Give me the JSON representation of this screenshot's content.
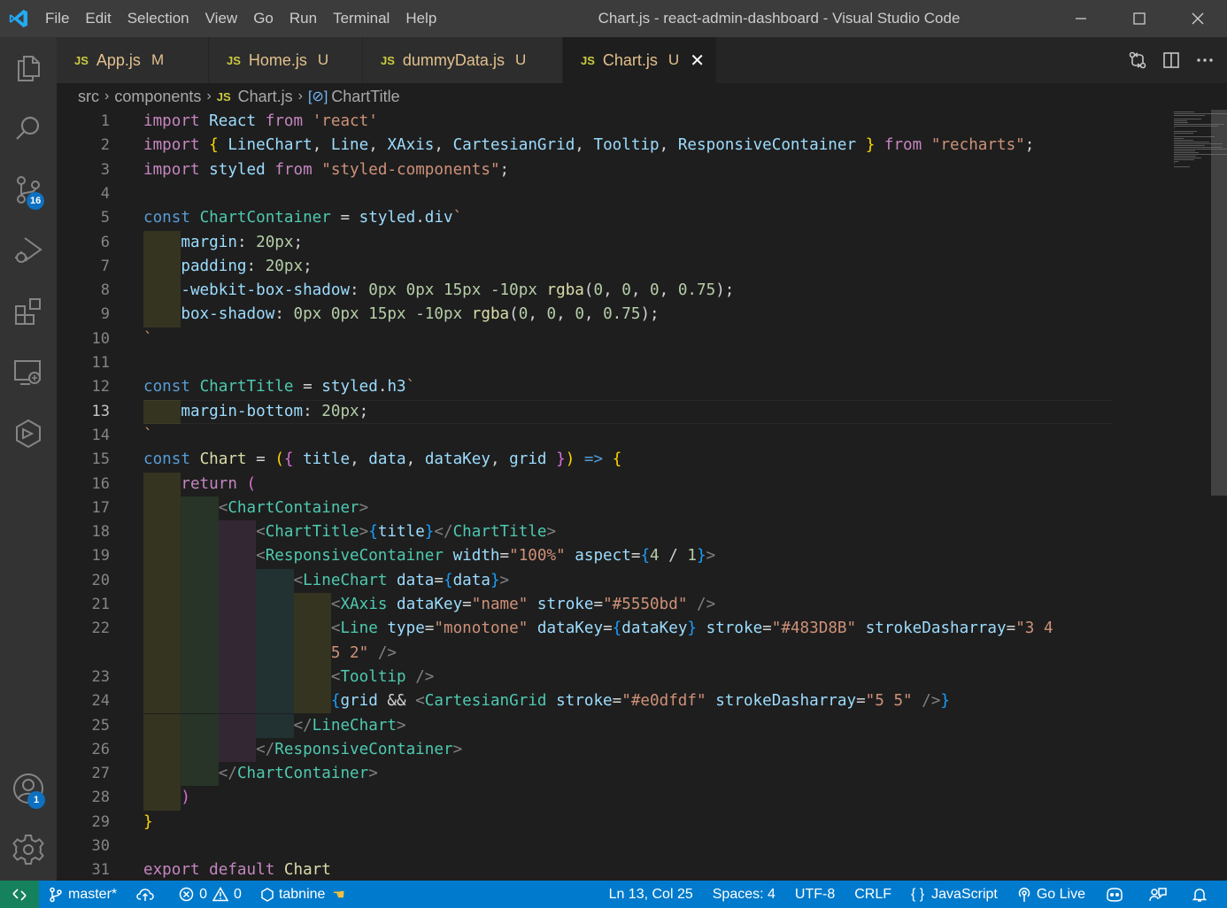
{
  "window": {
    "title": "Chart.js - react-admin-dashboard - Visual Studio Code"
  },
  "menu": [
    "File",
    "Edit",
    "Selection",
    "View",
    "Go",
    "Run",
    "Terminal",
    "Help"
  ],
  "activity": {
    "source_control_badge": "16",
    "accounts_badge": "1"
  },
  "tabs": [
    {
      "icon": "JS",
      "label": "App.js",
      "status": "M",
      "active": false
    },
    {
      "icon": "JS",
      "label": "Home.js",
      "status": "U",
      "active": false
    },
    {
      "icon": "JS",
      "label": "dummyData.js",
      "status": "U",
      "active": false
    },
    {
      "icon": "JS",
      "label": "Chart.js",
      "status": "U",
      "active": true
    }
  ],
  "breadcrumb": {
    "folder1": "src",
    "folder2": "components",
    "file_icon": "JS",
    "file": "Chart.js",
    "symbol": "ChartTitle"
  },
  "editor": {
    "current_line": 13,
    "line_numbers": [
      "1",
      "2",
      "3",
      "4",
      "5",
      "6",
      "7",
      "8",
      "9",
      "10",
      "11",
      "12",
      "13",
      "14",
      "15",
      "16",
      "17",
      "18",
      "19",
      "20",
      "21",
      "22",
      "",
      "23",
      "24",
      "25",
      "26",
      "27",
      "28",
      "29",
      "30",
      "31"
    ],
    "lines": [
      [
        [
          "kw2",
          "import"
        ],
        [
          "txt",
          " "
        ],
        [
          "var",
          "React"
        ],
        [
          "txt",
          " "
        ],
        [
          "kw2",
          "from"
        ],
        [
          "txt",
          " "
        ],
        [
          "str",
          "'react'"
        ]
      ],
      [
        [
          "kw2",
          "import"
        ],
        [
          "txt",
          " "
        ],
        [
          "br1",
          "{"
        ],
        [
          "txt",
          " "
        ],
        [
          "var",
          "LineChart"
        ],
        [
          "txt",
          ", "
        ],
        [
          "var",
          "Line"
        ],
        [
          "txt",
          ", "
        ],
        [
          "var",
          "XAxis"
        ],
        [
          "txt",
          ", "
        ],
        [
          "var",
          "CartesianGrid"
        ],
        [
          "txt",
          ", "
        ],
        [
          "var",
          "Tooltip"
        ],
        [
          "txt",
          ", "
        ],
        [
          "var",
          "ResponsiveContainer"
        ],
        [
          "txt",
          " "
        ],
        [
          "br1",
          "}"
        ],
        [
          "txt",
          " "
        ],
        [
          "kw2",
          "from"
        ],
        [
          "txt",
          " "
        ],
        [
          "str",
          "\"recharts\""
        ],
        [
          "txt",
          ";"
        ]
      ],
      [
        [
          "kw2",
          "import"
        ],
        [
          "txt",
          " "
        ],
        [
          "var",
          "styled"
        ],
        [
          "txt",
          " "
        ],
        [
          "kw2",
          "from"
        ],
        [
          "txt",
          " "
        ],
        [
          "str",
          "\"styled-components\""
        ],
        [
          "txt",
          ";"
        ]
      ],
      [],
      [
        [
          "kw",
          "const"
        ],
        [
          "txt",
          " "
        ],
        [
          "cls",
          "ChartContainer"
        ],
        [
          "txt",
          " = "
        ],
        [
          "var",
          "styled"
        ],
        [
          "txt",
          "."
        ],
        [
          "var",
          "div"
        ],
        [
          "str",
          "`"
        ]
      ],
      [
        [
          "txt",
          "    "
        ],
        [
          "var",
          "margin"
        ],
        [
          "txt",
          ": "
        ],
        [
          "num",
          "20px"
        ],
        [
          "txt",
          ";"
        ]
      ],
      [
        [
          "txt",
          "    "
        ],
        [
          "var",
          "padding"
        ],
        [
          "txt",
          ": "
        ],
        [
          "num",
          "20px"
        ],
        [
          "txt",
          ";"
        ]
      ],
      [
        [
          "txt",
          "    "
        ],
        [
          "var",
          "-webkit-box-shadow"
        ],
        [
          "txt",
          ": "
        ],
        [
          "num",
          "0px"
        ],
        [
          "txt",
          " "
        ],
        [
          "num",
          "0px"
        ],
        [
          "txt",
          " "
        ],
        [
          "num",
          "15px"
        ],
        [
          "txt",
          " "
        ],
        [
          "num",
          "-10px"
        ],
        [
          "txt",
          " "
        ],
        [
          "fn",
          "rgba"
        ],
        [
          "txt",
          "("
        ],
        [
          "num",
          "0"
        ],
        [
          "txt",
          ", "
        ],
        [
          "num",
          "0"
        ],
        [
          "txt",
          ", "
        ],
        [
          "num",
          "0"
        ],
        [
          "txt",
          ", "
        ],
        [
          "num",
          "0.75"
        ],
        [
          "txt",
          ");"
        ]
      ],
      [
        [
          "txt",
          "    "
        ],
        [
          "var",
          "box-shadow"
        ],
        [
          "txt",
          ": "
        ],
        [
          "num",
          "0px"
        ],
        [
          "txt",
          " "
        ],
        [
          "num",
          "0px"
        ],
        [
          "txt",
          " "
        ],
        [
          "num",
          "15px"
        ],
        [
          "txt",
          " "
        ],
        [
          "num",
          "-10px"
        ],
        [
          "txt",
          " "
        ],
        [
          "fn",
          "rgba"
        ],
        [
          "txt",
          "("
        ],
        [
          "num",
          "0"
        ],
        [
          "txt",
          ", "
        ],
        [
          "num",
          "0"
        ],
        [
          "txt",
          ", "
        ],
        [
          "num",
          "0"
        ],
        [
          "txt",
          ", "
        ],
        [
          "num",
          "0.75"
        ],
        [
          "txt",
          ");"
        ]
      ],
      [
        [
          "str",
          "`"
        ]
      ],
      [],
      [
        [
          "kw",
          "const"
        ],
        [
          "txt",
          " "
        ],
        [
          "cls",
          "ChartTitle"
        ],
        [
          "txt",
          " = "
        ],
        [
          "var",
          "styled"
        ],
        [
          "txt",
          "."
        ],
        [
          "var",
          "h3"
        ],
        [
          "str",
          "`"
        ]
      ],
      [
        [
          "txt",
          "    "
        ],
        [
          "var",
          "margin-bottom"
        ],
        [
          "txt",
          ": "
        ],
        [
          "num",
          "20px"
        ],
        [
          "txt",
          ";"
        ]
      ],
      [
        [
          "str",
          "`"
        ]
      ],
      [
        [
          "kw",
          "const"
        ],
        [
          "txt",
          " "
        ],
        [
          "fn",
          "Chart"
        ],
        [
          "txt",
          " = "
        ],
        [
          "br1",
          "("
        ],
        [
          "br2",
          "{"
        ],
        [
          "txt",
          " "
        ],
        [
          "var",
          "title"
        ],
        [
          "txt",
          ", "
        ],
        [
          "var",
          "data"
        ],
        [
          "txt",
          ", "
        ],
        [
          "var",
          "dataKey"
        ],
        [
          "txt",
          ", "
        ],
        [
          "var",
          "grid"
        ],
        [
          "txt",
          " "
        ],
        [
          "br2",
          "}"
        ],
        [
          "br1",
          ")"
        ],
        [
          "txt",
          " "
        ],
        [
          "kw",
          "=>"
        ],
        [
          "txt",
          " "
        ],
        [
          "br1",
          "{"
        ]
      ],
      [
        [
          "txt",
          "    "
        ],
        [
          "kw2",
          "return"
        ],
        [
          "txt",
          " "
        ],
        [
          "br2",
          "("
        ]
      ],
      [
        [
          "txt",
          "        "
        ],
        [
          "tag",
          "<"
        ],
        [
          "cls",
          "ChartContainer"
        ],
        [
          "tag",
          ">"
        ]
      ],
      [
        [
          "txt",
          "            "
        ],
        [
          "tag",
          "<"
        ],
        [
          "cls",
          "ChartTitle"
        ],
        [
          "tag",
          ">"
        ],
        [
          "br3",
          "{"
        ],
        [
          "var",
          "title"
        ],
        [
          "br3",
          "}"
        ],
        [
          "tag",
          "</"
        ],
        [
          "cls",
          "ChartTitle"
        ],
        [
          "tag",
          ">"
        ]
      ],
      [
        [
          "txt",
          "            "
        ],
        [
          "tag",
          "<"
        ],
        [
          "cls",
          "ResponsiveContainer"
        ],
        [
          "txt",
          " "
        ],
        [
          "attr",
          "width"
        ],
        [
          "txt",
          "="
        ],
        [
          "str",
          "\"100%\""
        ],
        [
          "txt",
          " "
        ],
        [
          "attr",
          "aspect"
        ],
        [
          "txt",
          "="
        ],
        [
          "br3",
          "{"
        ],
        [
          "num",
          "4"
        ],
        [
          "txt",
          " / "
        ],
        [
          "num",
          "1"
        ],
        [
          "br3",
          "}"
        ],
        [
          "tag",
          ">"
        ]
      ],
      [
        [
          "txt",
          "                "
        ],
        [
          "tag",
          "<"
        ],
        [
          "cls",
          "LineChart"
        ],
        [
          "txt",
          " "
        ],
        [
          "attr",
          "data"
        ],
        [
          "txt",
          "="
        ],
        [
          "br3",
          "{"
        ],
        [
          "var",
          "data"
        ],
        [
          "br3",
          "}"
        ],
        [
          "tag",
          ">"
        ]
      ],
      [
        [
          "txt",
          "                    "
        ],
        [
          "tag",
          "<"
        ],
        [
          "cls",
          "XAxis"
        ],
        [
          "txt",
          " "
        ],
        [
          "attr",
          "dataKey"
        ],
        [
          "txt",
          "="
        ],
        [
          "str",
          "\"name\""
        ],
        [
          "txt",
          " "
        ],
        [
          "attr",
          "stroke"
        ],
        [
          "txt",
          "="
        ],
        [
          "str",
          "\"#5550bd\""
        ],
        [
          "txt",
          " "
        ],
        [
          "tag",
          "/>"
        ]
      ],
      [
        [
          "txt",
          "                    "
        ],
        [
          "tag",
          "<"
        ],
        [
          "cls",
          "Line"
        ],
        [
          "txt",
          " "
        ],
        [
          "attr",
          "type"
        ],
        [
          "txt",
          "="
        ],
        [
          "str",
          "\"monotone\""
        ],
        [
          "txt",
          " "
        ],
        [
          "attr",
          "dataKey"
        ],
        [
          "txt",
          "="
        ],
        [
          "br3",
          "{"
        ],
        [
          "var",
          "dataKey"
        ],
        [
          "br3",
          "}"
        ],
        [
          "txt",
          " "
        ],
        [
          "attr",
          "stroke"
        ],
        [
          "txt",
          "="
        ],
        [
          "str",
          "\"#483D8B\""
        ],
        [
          "txt",
          " "
        ],
        [
          "attr",
          "strokeDasharray"
        ],
        [
          "txt",
          "="
        ],
        [
          "str",
          "\"3 4"
        ]
      ],
      [
        [
          "txt",
          "                    "
        ],
        [
          "str",
          "5 2\""
        ],
        [
          "txt",
          " "
        ],
        [
          "tag",
          "/>"
        ]
      ],
      [
        [
          "txt",
          "                    "
        ],
        [
          "tag",
          "<"
        ],
        [
          "cls",
          "Tooltip"
        ],
        [
          "txt",
          " "
        ],
        [
          "tag",
          "/>"
        ]
      ],
      [
        [
          "txt",
          "                    "
        ],
        [
          "br3",
          "{"
        ],
        [
          "var",
          "grid"
        ],
        [
          "txt",
          " && "
        ],
        [
          "tag",
          "<"
        ],
        [
          "cls",
          "CartesianGrid"
        ],
        [
          "txt",
          " "
        ],
        [
          "attr",
          "stroke"
        ],
        [
          "txt",
          "="
        ],
        [
          "str",
          "\"#e0dfdf\""
        ],
        [
          "txt",
          " "
        ],
        [
          "attr",
          "strokeDasharray"
        ],
        [
          "txt",
          "="
        ],
        [
          "str",
          "\"5 5\""
        ],
        [
          "txt",
          " "
        ],
        [
          "tag",
          "/>"
        ],
        [
          "br3",
          "}"
        ]
      ],
      [
        [
          "txt",
          "                "
        ],
        [
          "tag",
          "</"
        ],
        [
          "cls",
          "LineChart"
        ],
        [
          "tag",
          ">"
        ]
      ],
      [
        [
          "txt",
          "            "
        ],
        [
          "tag",
          "</"
        ],
        [
          "cls",
          "ResponsiveContainer"
        ],
        [
          "tag",
          ">"
        ]
      ],
      [
        [
          "txt",
          "        "
        ],
        [
          "tag",
          "</"
        ],
        [
          "cls",
          "ChartContainer"
        ],
        [
          "tag",
          ">"
        ]
      ],
      [
        [
          "txt",
          "    "
        ],
        [
          "br2",
          ")"
        ]
      ],
      [
        [
          "br1",
          "}"
        ]
      ],
      [],
      [
        [
          "kw2",
          "export"
        ],
        [
          "txt",
          " "
        ],
        [
          "kw2",
          "default"
        ],
        [
          "txt",
          " "
        ],
        [
          "fn",
          "Chart"
        ]
      ]
    ]
  },
  "status": {
    "branch": "master*",
    "errors": "0",
    "warnings": "0",
    "tabnine": "tabnine",
    "position": "Ln 13, Col 25",
    "spaces": "Spaces: 4",
    "encoding": "UTF-8",
    "eol": "CRLF",
    "language": "JavaScript",
    "golive": "Go Live"
  },
  "icons": [
    "vscode-logo-icon",
    "files-icon",
    "search-icon",
    "source-control-icon",
    "run-debug-icon",
    "extensions-icon",
    "remote-explorer-icon",
    "tabnine-hub-icon",
    "account-icon",
    "gear-icon",
    "compare-changes-icon",
    "split-editor-icon",
    "more-actions-icon",
    "remote-icon",
    "git-branch-icon",
    "sync-icon",
    "error-icon",
    "warning-icon",
    "bell-icon",
    "feedback-icon",
    "copilot-icon",
    "go-live-icon"
  ]
}
